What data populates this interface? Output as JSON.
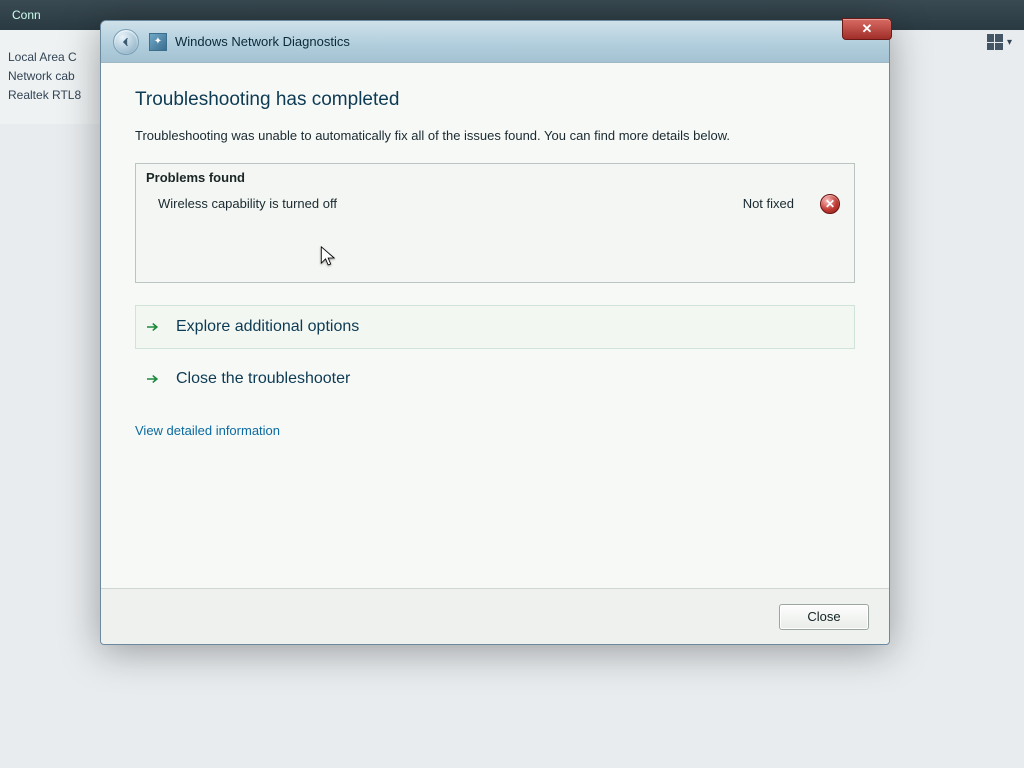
{
  "parent": {
    "menu_conn": "Conn",
    "sidebar": {
      "line1": "Local Area C",
      "line2": "Network cab",
      "line3": "Realtek RTL8"
    }
  },
  "wizard": {
    "title": "Windows Network Diagnostics",
    "heading": "Troubleshooting has completed",
    "description": "Troubleshooting was unable to automatically fix all of the issues found. You can find more details below.",
    "problems_header": "Problems found",
    "problems": [
      {
        "name": "Wireless capability is turned off",
        "status": "Not fixed",
        "icon": "error"
      }
    ],
    "options": {
      "explore": "Explore additional options",
      "close_ts": "Close the troubleshooter"
    },
    "detail_link": "View detailed information",
    "close_button": "Close"
  }
}
